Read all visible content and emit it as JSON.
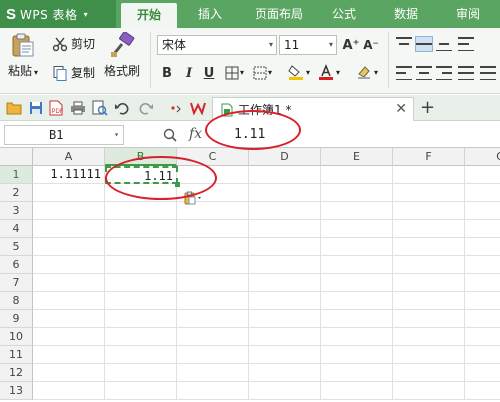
{
  "app": {
    "logo": "S",
    "name": "WPS 表格",
    "caret": "▾"
  },
  "menu_tabs": [
    {
      "label": "开始",
      "active": true
    },
    {
      "label": "插入",
      "active": false
    },
    {
      "label": "页面布局",
      "active": false
    },
    {
      "label": "公式",
      "active": false
    },
    {
      "label": "数据",
      "active": false
    },
    {
      "label": "审阅",
      "active": false
    }
  ],
  "ribbon": {
    "paste": {
      "label": "粘贴",
      "caret": "▾",
      "icon": "clipboard-icon"
    },
    "cut": {
      "label": "剪切",
      "icon": "scissors-icon"
    },
    "copy": {
      "label": "复制",
      "icon": "copy-icon"
    },
    "format_painter": {
      "label": "格式刷",
      "icon": "brush-icon"
    },
    "font_name": "宋体",
    "font_size": "11",
    "grow_font": "A⁺",
    "shrink_font": "A⁻",
    "bold": "B",
    "italic": "I",
    "underline": "U",
    "caret": "▾"
  },
  "quick_access": {
    "icons": [
      "open-folder-icon",
      "save-icon",
      "export-pdf-icon",
      "print-icon",
      "print-preview-icon",
      "undo-icon",
      "redo-icon",
      "more-icon"
    ]
  },
  "document_tab": {
    "title": "工作簿1 *",
    "close": "✕",
    "new_tab": "+"
  },
  "formula_bar": {
    "name_box": "B1",
    "fx": "fx",
    "content": "1.11"
  },
  "grid": {
    "columns": [
      "A",
      "B",
      "C",
      "D",
      "E",
      "F",
      "G"
    ],
    "rows": [
      "1",
      "2",
      "3",
      "4",
      "5",
      "6",
      "7",
      "8",
      "9",
      "10",
      "11",
      "12",
      "13"
    ],
    "cells": {
      "A1": "1.11111",
      "B1": "1.11"
    },
    "selected_cell": "B1"
  },
  "colors": {
    "title_green": "#5aa562",
    "app_button": "#3f8f4a",
    "annotation_red": "#d8202a",
    "selection_green": "#3f9a48"
  }
}
